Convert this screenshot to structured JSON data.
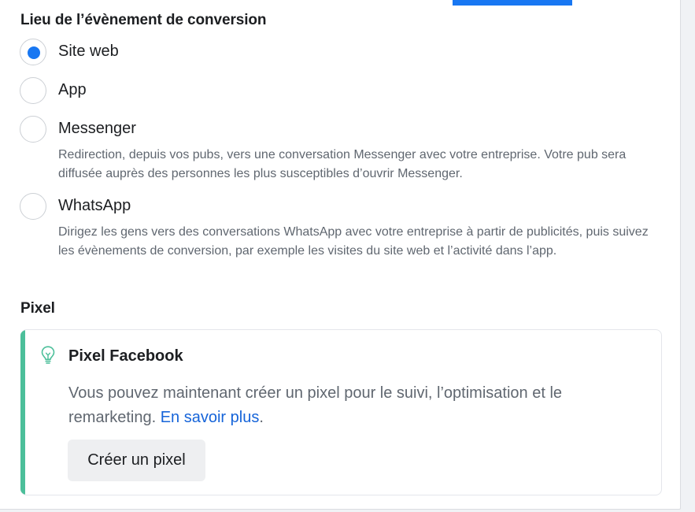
{
  "conversion_section": {
    "title": "Lieu de l’évènement de conversion",
    "options": [
      {
        "label": "Site web",
        "description": "",
        "checked": true
      },
      {
        "label": "App",
        "description": "",
        "checked": false
      },
      {
        "label": "Messenger",
        "description": "Redirection, depuis vos pubs, vers une conversation Messenger avec votre entreprise. Votre pub sera diffusée auprès des personnes les plus susceptibles d’ouvrir Messenger.",
        "checked": false
      },
      {
        "label": "WhatsApp",
        "description": "Dirigez les gens vers des conversations WhatsApp avec votre entreprise à partir de publicités, puis suivez les évènements de conversion, par exemple les visites du site web et l’activité dans l’app.",
        "checked": false
      }
    ]
  },
  "pixel_section": {
    "title": "Pixel",
    "card": {
      "icon": "lightbulb-icon",
      "title": "Pixel Facebook",
      "body": "Vous pouvez maintenant créer un pixel pour le suivi, l’optimisation et le remarketing. ",
      "link_label": "En savoir plus",
      "body_end": ".",
      "button_label": "Créer un pixel"
    }
  },
  "colors": {
    "accent": "#1877f2",
    "card_accent": "#4cbf9a",
    "link": "#1664d9"
  }
}
